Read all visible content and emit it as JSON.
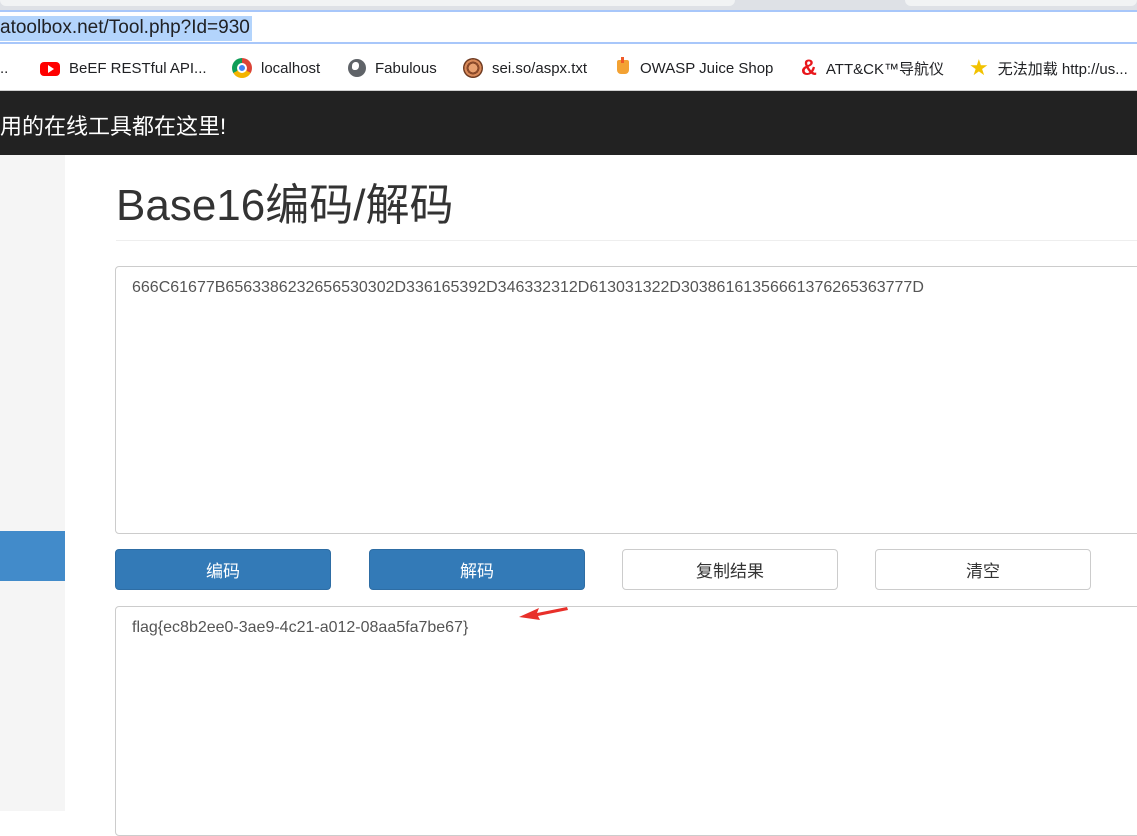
{
  "browser": {
    "url": "atoolbox.net/Tool.php?Id=930",
    "bookmarks": [
      {
        "label": "..",
        "icon": "none"
      },
      {
        "label": "BeEF RESTful API...",
        "icon": "youtube-icon"
      },
      {
        "label": "localhost",
        "icon": "chrome-icon"
      },
      {
        "label": "Fabulous",
        "icon": "globe-icon"
      },
      {
        "label": "sei.so/aspx.txt",
        "icon": "sei-icon"
      },
      {
        "label": "OWASP Juice Shop",
        "icon": "juice-shop-icon"
      },
      {
        "label": "ATT&CK™导航仪",
        "icon": "attack-icon"
      },
      {
        "label": "无法加载 http://us...",
        "icon": "star-icon"
      }
    ]
  },
  "site": {
    "header_text": "用的在线工具都在这里!"
  },
  "main": {
    "title": "Base16编码/解码",
    "input_value": "666C61677B6563386232656530302D336165392D346332312D613031322D30386161356661376265363777D",
    "buttons": {
      "encode": "编码",
      "decode": "解码",
      "copy": "复制结果",
      "clear": "清空"
    },
    "output_value": "flag{ec8b2ee0-3ae9-4c21-a012-08aa5fa7be67}"
  },
  "colors": {
    "primary": "#337ab7",
    "header_bg": "#222222",
    "sidebar_active": "#428bca",
    "annotation_arrow": "#e8302a"
  }
}
